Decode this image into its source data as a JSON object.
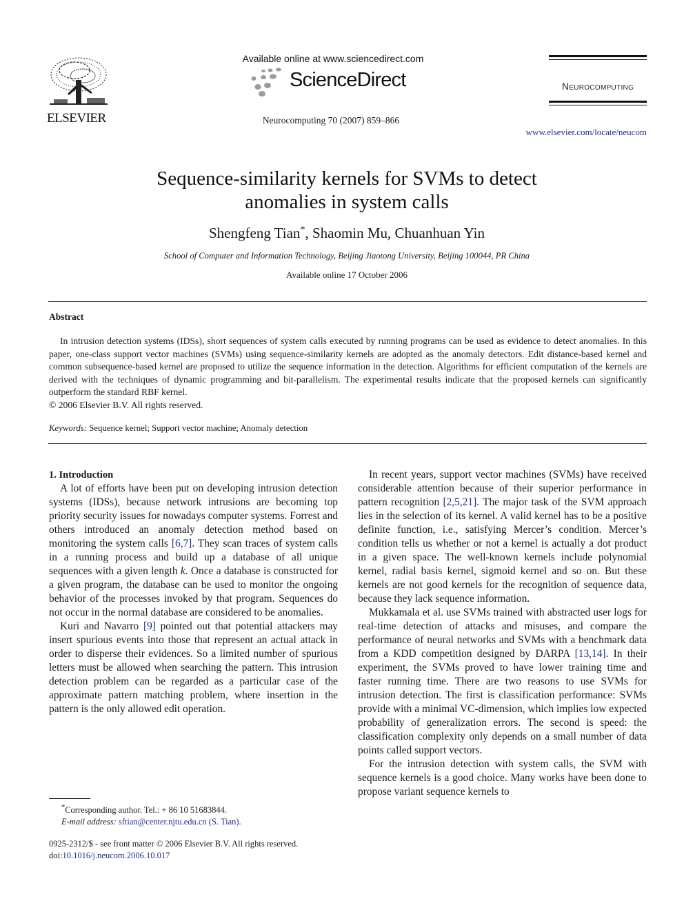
{
  "header": {
    "publisher_logo_text": "ELSEVIER",
    "available_online": "Available online at www.sciencedirect.com",
    "sciencedirect_logo_text": "ScienceDirect",
    "journal_reference": "Neurocomputing 70 (2007) 859–866",
    "journal_name": "Neurocomputing",
    "journal_url": "www.elsevier.com/locate/neucom"
  },
  "article": {
    "title_line1": "Sequence-similarity kernels for SVMs to detect",
    "title_line2": "anomalies in system calls",
    "authors": [
      {
        "name": "Shengfeng Tian",
        "mark": "*"
      },
      {
        "name": "Shaomin Mu",
        "mark": ""
      },
      {
        "name": "Chuanhuan Yin",
        "mark": ""
      }
    ],
    "affiliation": "School of Computer and Information Technology, Beijing Jiaotong University, Beijing 100044, PR China",
    "available_date": "Available online 17 October 2006"
  },
  "abstract": {
    "heading": "Abstract",
    "body": "In intrusion detection systems (IDSs), short sequences of system calls executed by running programs can be used as evidence to detect anomalies. In this paper, one-class support vector machines (SVMs) using sequence-similarity kernels are adopted as the anomaly detectors. Edit distance-based kernel and common subsequence-based kernel are proposed to utilize the sequence information in the detection. Algorithms for efficient computation of the kernels are derived with the techniques of dynamic programming and bit-parallelism. The experimental results indicate that the proposed kernels can significantly outperform the standard RBF kernel.",
    "copyright": "© 2006 Elsevier B.V. All rights reserved.",
    "keywords_label": "Keywords:",
    "keywords": "Sequence kernel; Support vector machine; Anomaly detection"
  },
  "sections": {
    "intro_heading": "1.  Introduction",
    "left": {
      "p1_a": "A lot of efforts have been put on developing intrusion detection systems (IDSs), because network intrusions are becoming top priority security issues for nowadays computer systems. Forrest and others introduced an anomaly detection method based on monitoring the system calls ",
      "p1_ref": "[6,7]",
      "p1_b": ". They scan traces of system calls in a running process and build up a database of all unique sequences with a given length ",
      "p1_k": "k",
      "p1_c": ". Once a database is constructed for a given program, the database can be used to monitor the ongoing behavior of the processes invoked by that program. Sequences do not occur in the normal database are considered to be anomalies.",
      "p2_a": "Kuri and Navarro ",
      "p2_ref": "[9]",
      "p2_b": " pointed out that potential attackers may insert spurious events into those that represent an actual attack in order to disperse their evidences. So a limited number of spurious letters must be allowed when searching the pattern. This intrusion detection problem can be regarded as a particular case of the approximate pattern matching problem, where insertion in the pattern is the only allowed edit operation."
    },
    "right": {
      "p1_a": "In recent years, support vector machines (SVMs) have received considerable attention because of their superior performance in pattern recognition ",
      "p1_ref": "[2,5,21]",
      "p1_b": ". The major task of the SVM approach lies in the selection of its kernel. A valid kernel has to be a positive definite function, i.e., satisfying Mercer’s condition. Mercer’s condition tells us whether or not a kernel is actually a dot product in a given space. The well-known kernels include polynomial kernel, radial basis kernel, sigmoid kernel and so on. But these kernels are not good kernels for the recognition of sequence data, because they lack sequence information.",
      "p2_a": "Mukkamala et al. use SVMs trained with abstracted user logs for real-time detection of attacks and misuses, and compare the performance of neural networks and SVMs with a benchmark data from a KDD competition designed by DARPA ",
      "p2_ref": "[13,14]",
      "p2_b": ". In their experiment, the SVMs proved to have lower training time and faster running time. There are two reasons to use SVMs for intrusion detection. The first is classification performance: SVMs provide with a minimal VC-dimension, which implies low expected probability of generalization errors. The second is speed: the classification complexity only depends on a small number of data points called support vectors.",
      "p3": "For the intrusion detection with system calls, the SVM with sequence kernels is a good choice. Many works have been done to propose variant sequence kernels to"
    }
  },
  "footnotes": {
    "corresponding_mark": "*",
    "corresponding": "Corresponding author. Tel.:  + 86 10 51683844.",
    "email_label": "E-mail address:",
    "email": "sftian@center.njtu.edu.cn (S. Tian).",
    "front_matter": "0925-2312/$ - see front matter © 2006 Elsevier B.V. All rights reserved.",
    "doi_label": "doi:",
    "doi": "10.1016/j.neucom.2006.10.017"
  },
  "colors": {
    "link": "#1f2e8c",
    "text": "#1a1a1a"
  }
}
